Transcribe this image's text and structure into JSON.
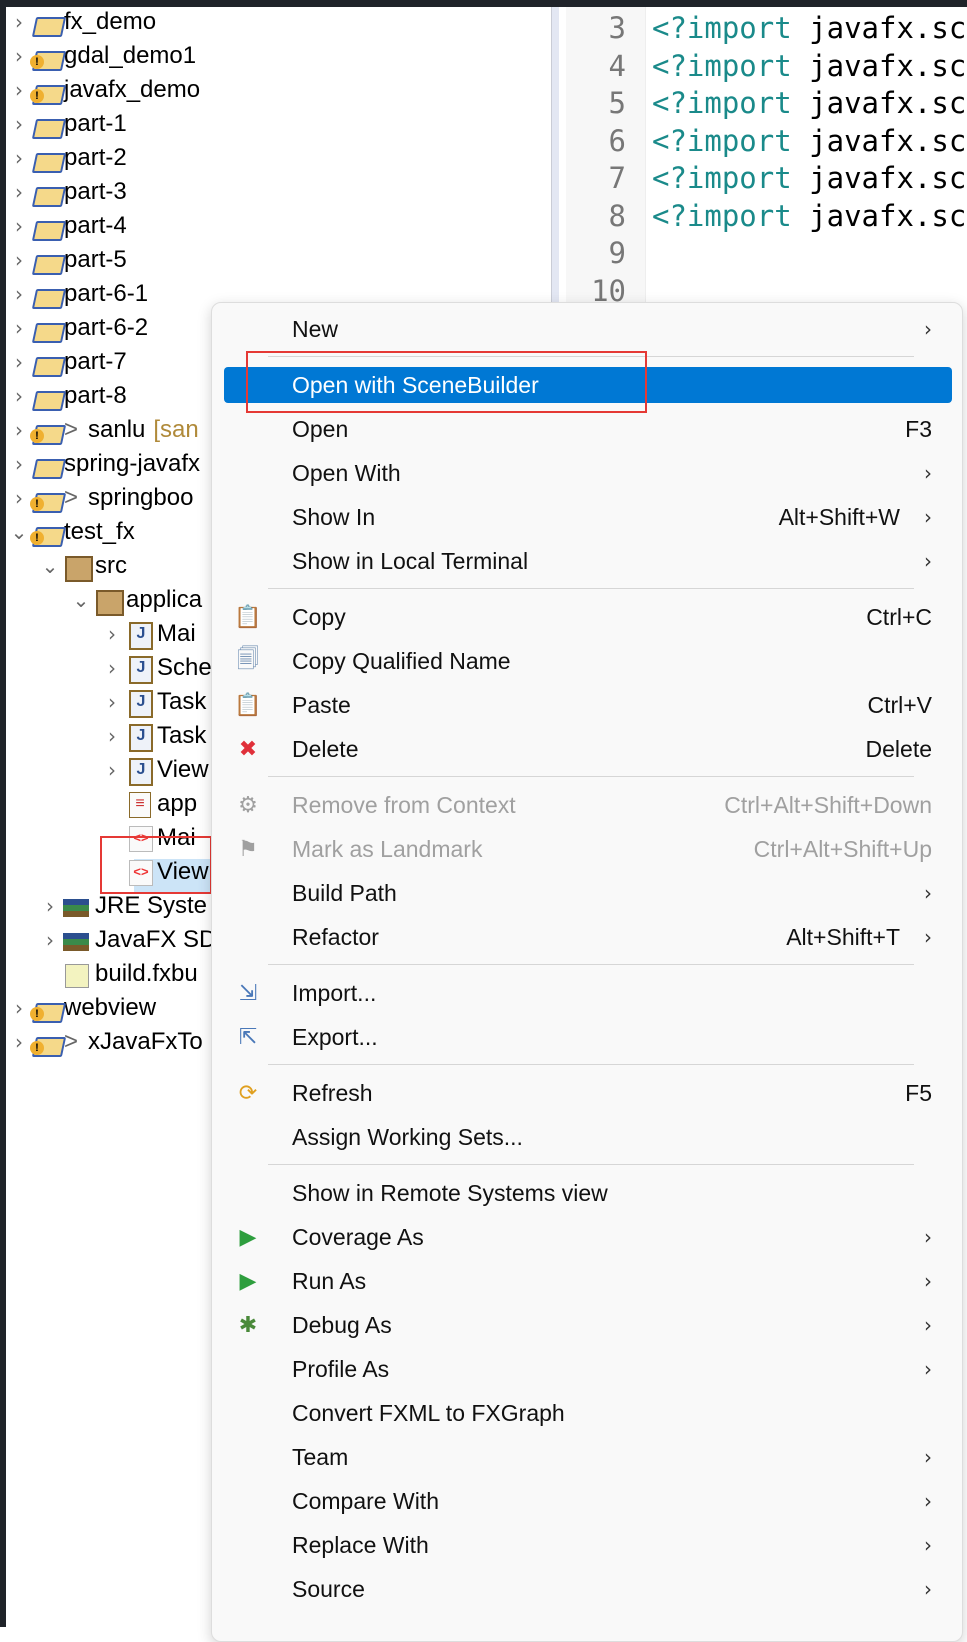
{
  "tree": [
    {
      "label": "fx_demo",
      "chev": "›",
      "indent": 0,
      "icon": "proj"
    },
    {
      "label": "gdal_demo1",
      "chev": "›",
      "indent": 0,
      "icon": "proj warn"
    },
    {
      "label": "javafx_demo",
      "chev": "›",
      "indent": 0,
      "icon": "proj warn"
    },
    {
      "label": "part-1",
      "chev": "›",
      "indent": 0,
      "icon": "proj"
    },
    {
      "label": "part-2",
      "chev": "›",
      "indent": 0,
      "icon": "proj"
    },
    {
      "label": "part-3",
      "chev": "›",
      "indent": 0,
      "icon": "proj"
    },
    {
      "label": "part-4",
      "chev": "›",
      "indent": 0,
      "icon": "proj"
    },
    {
      "label": "part-5",
      "chev": "›",
      "indent": 0,
      "icon": "proj"
    },
    {
      "label": "part-6-1",
      "chev": "›",
      "indent": 0,
      "icon": "proj"
    },
    {
      "label": "part-6-2",
      "chev": "›",
      "indent": 0,
      "icon": "proj"
    },
    {
      "label": "part-7",
      "chev": "›",
      "indent": 0,
      "icon": "proj"
    },
    {
      "label": "part-8",
      "chev": "›",
      "indent": 0,
      "icon": "proj"
    },
    {
      "label": "sanlu",
      "prefix": ">",
      "suffix": "[san",
      "chev": "›",
      "indent": 0,
      "icon": "proj warn"
    },
    {
      "label": "spring-javafx",
      "chev": "›",
      "indent": 0,
      "icon": "proj"
    },
    {
      "label": "springboo",
      "prefix": ">",
      "chev": "›",
      "indent": 0,
      "icon": "proj warn"
    },
    {
      "label": "test_fx",
      "chev": "⌄",
      "indent": 0,
      "icon": "proj warn"
    },
    {
      "label": "src",
      "chev": "⌄",
      "indent": 1,
      "icon": "pkg"
    },
    {
      "label": "applica",
      "chev": "⌄",
      "indent": 2,
      "icon": "pkg"
    },
    {
      "label": "Mai",
      "chev": "›",
      "indent": 3,
      "icon": "java"
    },
    {
      "label": "Sche",
      "chev": "›",
      "indent": 3,
      "icon": "java"
    },
    {
      "label": "Task",
      "chev": "›",
      "indent": 3,
      "icon": "java"
    },
    {
      "label": "Task",
      "chev": "›",
      "indent": 3,
      "icon": "java"
    },
    {
      "label": "View",
      "chev": "›",
      "indent": 3,
      "icon": "java"
    },
    {
      "label": "app",
      "chev": "",
      "indent": 3,
      "icon": "props"
    },
    {
      "label": "Mai",
      "chev": "",
      "indent": 3,
      "icon": "fxml"
    },
    {
      "label": "View",
      "chev": "",
      "indent": 3,
      "icon": "fxml"
    },
    {
      "label": "JRE Syste",
      "chev": "›",
      "indent": 1,
      "icon": "lib"
    },
    {
      "label": "JavaFX SD",
      "chev": "›",
      "indent": 1,
      "icon": "lib"
    },
    {
      "label": "build.fxbu",
      "chev": "",
      "indent": 1,
      "icon": "build"
    },
    {
      "label": "webview",
      "chev": "›",
      "indent": 0,
      "icon": "proj warn"
    },
    {
      "label": "xJavaFxTo",
      "prefix": ">",
      "chev": "›",
      "indent": 0,
      "icon": "proj warn"
    }
  ],
  "editor": {
    "lines": [
      {
        "n": "3",
        "kw": "<?import",
        "tx": " javafx.sc"
      },
      {
        "n": "4",
        "kw": "<?import",
        "tx": " javafx.sc"
      },
      {
        "n": "5",
        "kw": "<?import",
        "tx": " javafx.sc"
      },
      {
        "n": "6",
        "kw": "<?import",
        "tx": " javafx.sc"
      },
      {
        "n": "7",
        "kw": "<?import",
        "tx": " javafx.sc"
      },
      {
        "n": "8",
        "kw": "<?import",
        "tx": " javafx.sc"
      },
      {
        "n": "9",
        "kw": "",
        "tx": ""
      },
      {
        "n": "10",
        "kw": "",
        "tx": ""
      }
    ]
  },
  "menu": [
    {
      "label": "New",
      "arrow": "›"
    },
    {
      "sep": true
    },
    {
      "label": "Open with SceneBuilder",
      "selected": true
    },
    {
      "label": "Open",
      "shortcut": "F3"
    },
    {
      "label": "Open With",
      "arrow": "›"
    },
    {
      "label": "Show In",
      "shortcut": "Alt+Shift+W",
      "arrow": "›"
    },
    {
      "label": "Show in Local Terminal",
      "arrow": "›"
    },
    {
      "sep": true
    },
    {
      "label": "Copy",
      "shortcut": "Ctrl+C",
      "icon": "copy-icon",
      "glyph": "📋"
    },
    {
      "label": "Copy Qualified Name",
      "icon": "copy-qualified-name-icon",
      "glyph": "🗐"
    },
    {
      "label": "Paste",
      "shortcut": "Ctrl+V",
      "icon": "paste-icon",
      "glyph": "📋"
    },
    {
      "label": "Delete",
      "shortcut": "Delete",
      "icon": "delete-icon",
      "glyph": "✖",
      "color": "#e0303a"
    },
    {
      "sep": true
    },
    {
      "label": "Remove from Context",
      "shortcut": "Ctrl+Alt+Shift+Down",
      "disabled": true,
      "icon": "remove-context-icon",
      "glyph": "⚙"
    },
    {
      "label": "Mark as Landmark",
      "shortcut": "Ctrl+Alt+Shift+Up",
      "disabled": true,
      "icon": "landmark-icon",
      "glyph": "⚑"
    },
    {
      "label": "Build Path",
      "arrow": "›"
    },
    {
      "label": "Refactor",
      "shortcut": "Alt+Shift+T",
      "arrow": "›"
    },
    {
      "sep": true
    },
    {
      "label": "Import...",
      "icon": "import-icon",
      "glyph": "⇲",
      "color": "#4a78b8"
    },
    {
      "label": "Export...",
      "icon": "export-icon",
      "glyph": "⇱",
      "color": "#4a78b8"
    },
    {
      "sep": true
    },
    {
      "label": "Refresh",
      "shortcut": "F5",
      "icon": "refresh-icon",
      "glyph": "⟳",
      "color": "#e0a020"
    },
    {
      "label": "Assign Working Sets..."
    },
    {
      "sep": true
    },
    {
      "label": "Show in Remote Systems view"
    },
    {
      "label": "Coverage As",
      "arrow": "›",
      "icon": "coverage-icon",
      "glyph": "▶",
      "color": "#2e9e3e"
    },
    {
      "label": "Run As",
      "arrow": "›",
      "icon": "run-icon",
      "glyph": "▶",
      "color": "#2e9e3e"
    },
    {
      "label": "Debug As",
      "arrow": "›",
      "icon": "debug-icon",
      "glyph": "✱",
      "color": "#4a8a3a"
    },
    {
      "label": "Profile As",
      "arrow": "›"
    },
    {
      "label": "Convert FXML to FXGraph"
    },
    {
      "label": "Team",
      "arrow": "›"
    },
    {
      "label": "Compare With",
      "arrow": "›"
    },
    {
      "label": "Replace With",
      "arrow": "›"
    },
    {
      "label": "Source",
      "arrow": "›"
    }
  ],
  "colors": {
    "selection": "#0078d4",
    "highlight_box": "#e53935"
  }
}
